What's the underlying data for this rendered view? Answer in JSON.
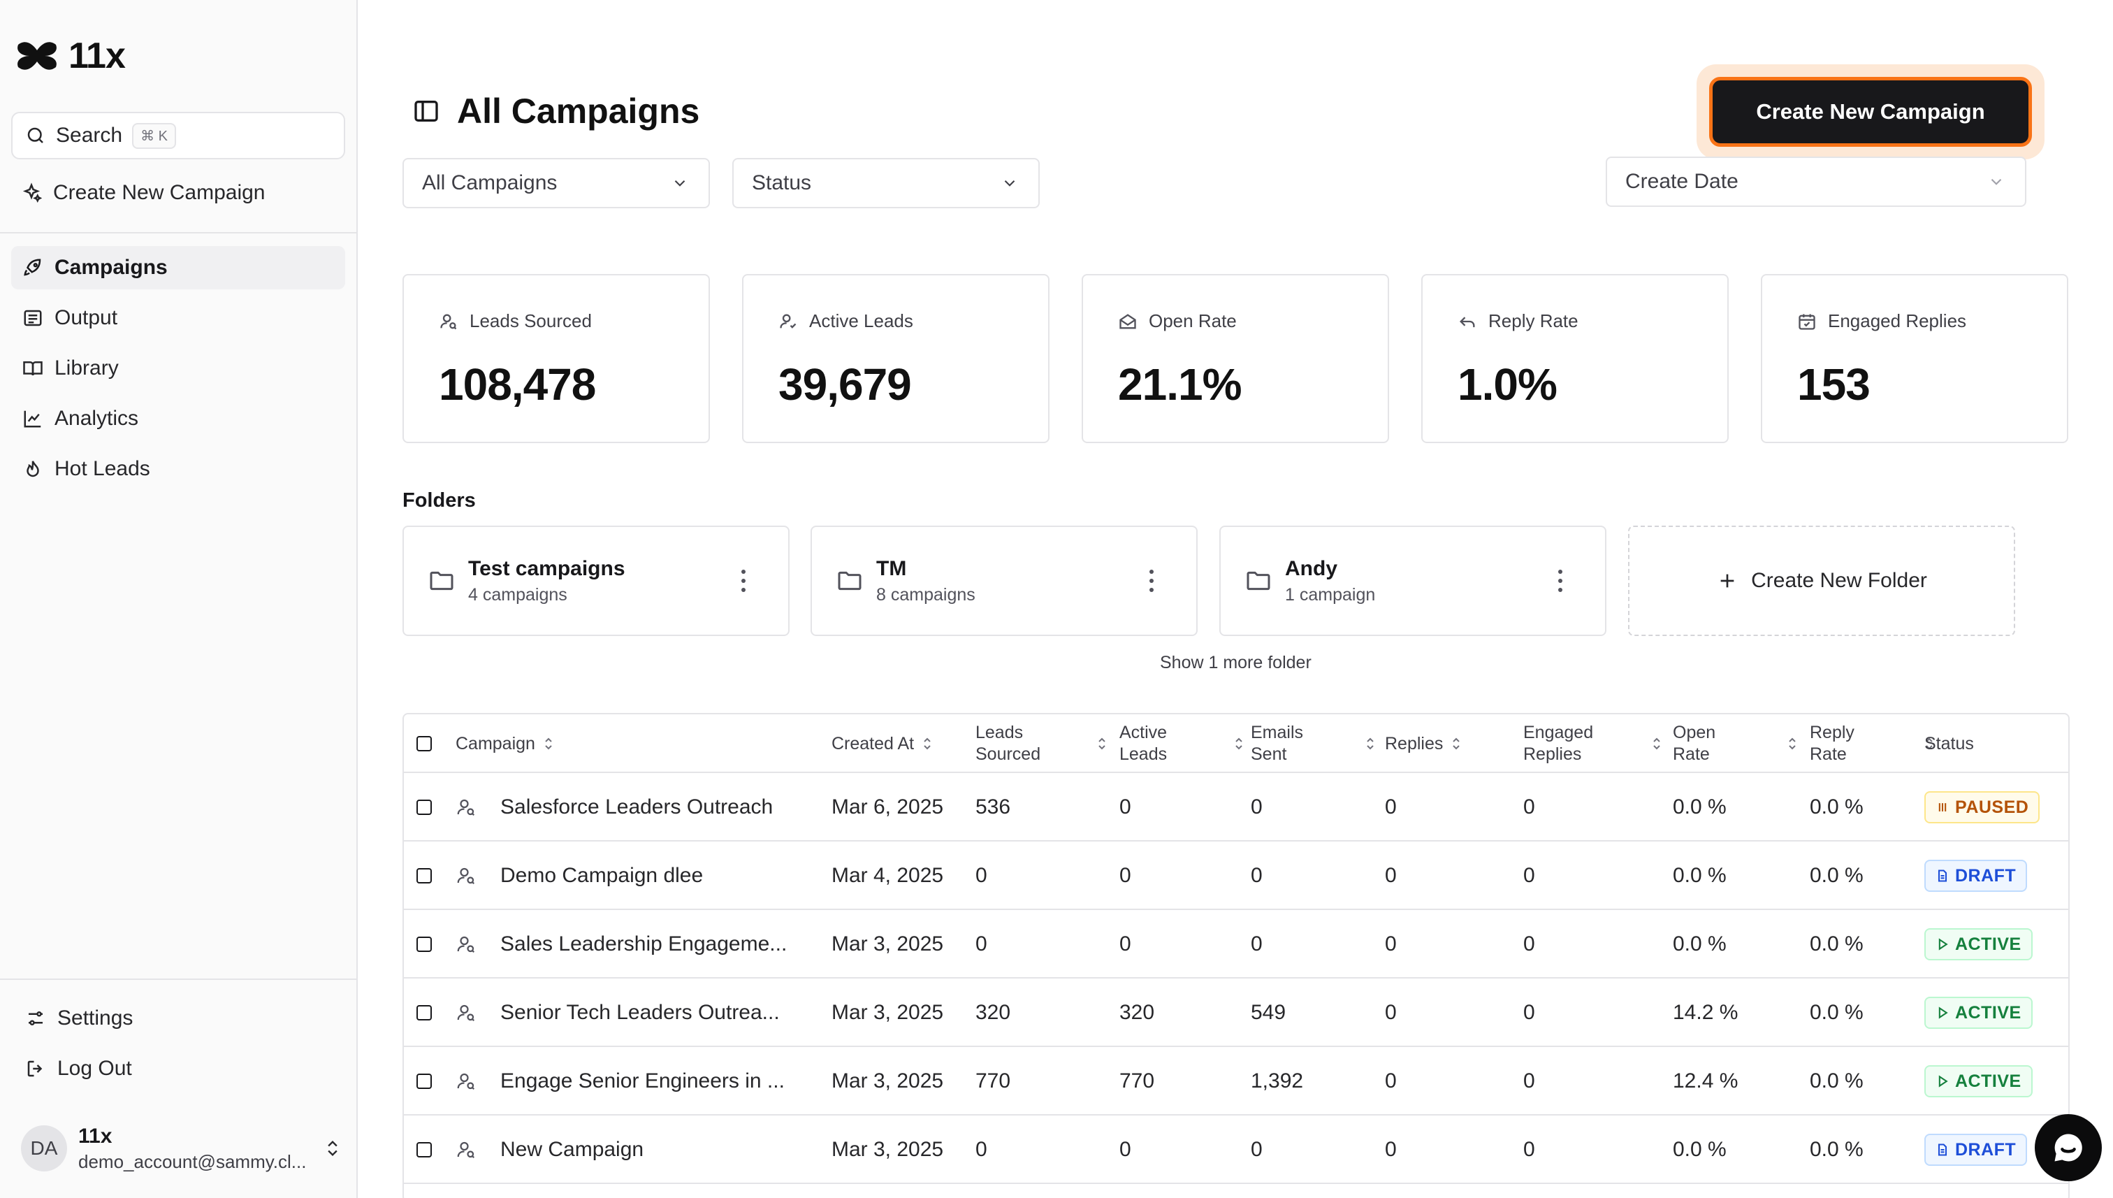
{
  "sidebar": {
    "logo_text": "11x",
    "search": {
      "label": "Search",
      "shortcut": "⌘ K"
    },
    "create_label": "Create New Campaign",
    "nav": [
      {
        "label": "Campaigns",
        "icon": "rocket-icon"
      },
      {
        "label": "Output",
        "icon": "list-icon"
      },
      {
        "label": "Library",
        "icon": "book-icon"
      },
      {
        "label": "Analytics",
        "icon": "chart-line-icon"
      },
      {
        "label": "Hot Leads",
        "icon": "flame-icon"
      }
    ],
    "bottom": [
      {
        "label": "Settings",
        "icon": "sliders-icon"
      },
      {
        "label": "Log Out",
        "icon": "logout-icon"
      }
    ],
    "user": {
      "initials": "DA",
      "name": "11x",
      "email": "demo_account@sammy.cl..."
    }
  },
  "header": {
    "title": "All Campaigns",
    "create_button": "Create New Campaign"
  },
  "filters": {
    "campaigns": "All Campaigns",
    "status": "Status",
    "date": "Create Date"
  },
  "stats": [
    {
      "label": "Leads Sourced",
      "value": "108,478",
      "icon": "user-search-icon"
    },
    {
      "label": "Active Leads",
      "value": "39,679",
      "icon": "user-check-icon"
    },
    {
      "label": "Open Rate",
      "value": "21.1%",
      "icon": "mail-open-icon"
    },
    {
      "label": "Reply Rate",
      "value": "1.0%",
      "icon": "reply-icon"
    },
    {
      "label": "Engaged Replies",
      "value": "153",
      "icon": "calendar-check-icon"
    }
  ],
  "folders": {
    "title": "Folders",
    "items": [
      {
        "name": "Test campaigns",
        "count": "4 campaigns"
      },
      {
        "name": "TM",
        "count": "8 campaigns"
      },
      {
        "name": "Andy",
        "count": "1 campaign"
      }
    ],
    "create_label": "Create New Folder",
    "show_more": "Show 1 more folder"
  },
  "table": {
    "headers": {
      "campaign": "Campaign",
      "created_at": "Created At",
      "leads_sourced": [
        "Leads",
        "Sourced"
      ],
      "active_leads": [
        "Active",
        "Leads"
      ],
      "emails_sent": [
        "Emails",
        "Sent"
      ],
      "replies": "Replies",
      "engaged_replies": [
        "Engaged",
        "Replies"
      ],
      "open_rate": [
        "Open",
        "Rate"
      ],
      "reply_rate": [
        "Reply",
        "Rate"
      ],
      "status": "Status"
    },
    "rows": [
      {
        "name": "Salesforce Leaders Outreach",
        "created": "Mar 6, 2025",
        "leads": "536",
        "active": "0",
        "emails": "0",
        "replies": "0",
        "engaged": "0",
        "open": "0.0 %",
        "reply": "0.0 %",
        "status": "PAUSED",
        "status_type": "paused"
      },
      {
        "name": "Demo Campaign dlee",
        "created": "Mar 4, 2025",
        "leads": "0",
        "active": "0",
        "emails": "0",
        "replies": "0",
        "engaged": "0",
        "open": "0.0 %",
        "reply": "0.0 %",
        "status": "DRAFT",
        "status_type": "draft"
      },
      {
        "name": "Sales Leadership Engageme...",
        "created": "Mar 3, 2025",
        "leads": "0",
        "active": "0",
        "emails": "0",
        "replies": "0",
        "engaged": "0",
        "open": "0.0 %",
        "reply": "0.0 %",
        "status": "ACTIVE",
        "status_type": "active"
      },
      {
        "name": "Senior Tech Leaders Outrea...",
        "created": "Mar 3, 2025",
        "leads": "320",
        "active": "320",
        "emails": "549",
        "replies": "0",
        "engaged": "0",
        "open": "14.2 %",
        "reply": "0.0 %",
        "status": "ACTIVE",
        "status_type": "active"
      },
      {
        "name": "Engage Senior Engineers in ...",
        "created": "Mar 3, 2025",
        "leads": "770",
        "active": "770",
        "emails": "1,392",
        "replies": "0",
        "engaged": "0",
        "open": "12.4 %",
        "reply": "0.0 %",
        "status": "ACTIVE",
        "status_type": "active"
      },
      {
        "name": "New Campaign",
        "created": "Mar 3, 2025",
        "leads": "0",
        "active": "0",
        "emails": "0",
        "replies": "0",
        "engaged": "0",
        "open": "0.0 %",
        "reply": "0.0 %",
        "status": "DRAFT",
        "status_type": "draft"
      }
    ]
  },
  "colors": {
    "accent_ring": "#f97316",
    "paused": "#b45309",
    "draft": "#1d4ed8",
    "active": "#15803d"
  }
}
